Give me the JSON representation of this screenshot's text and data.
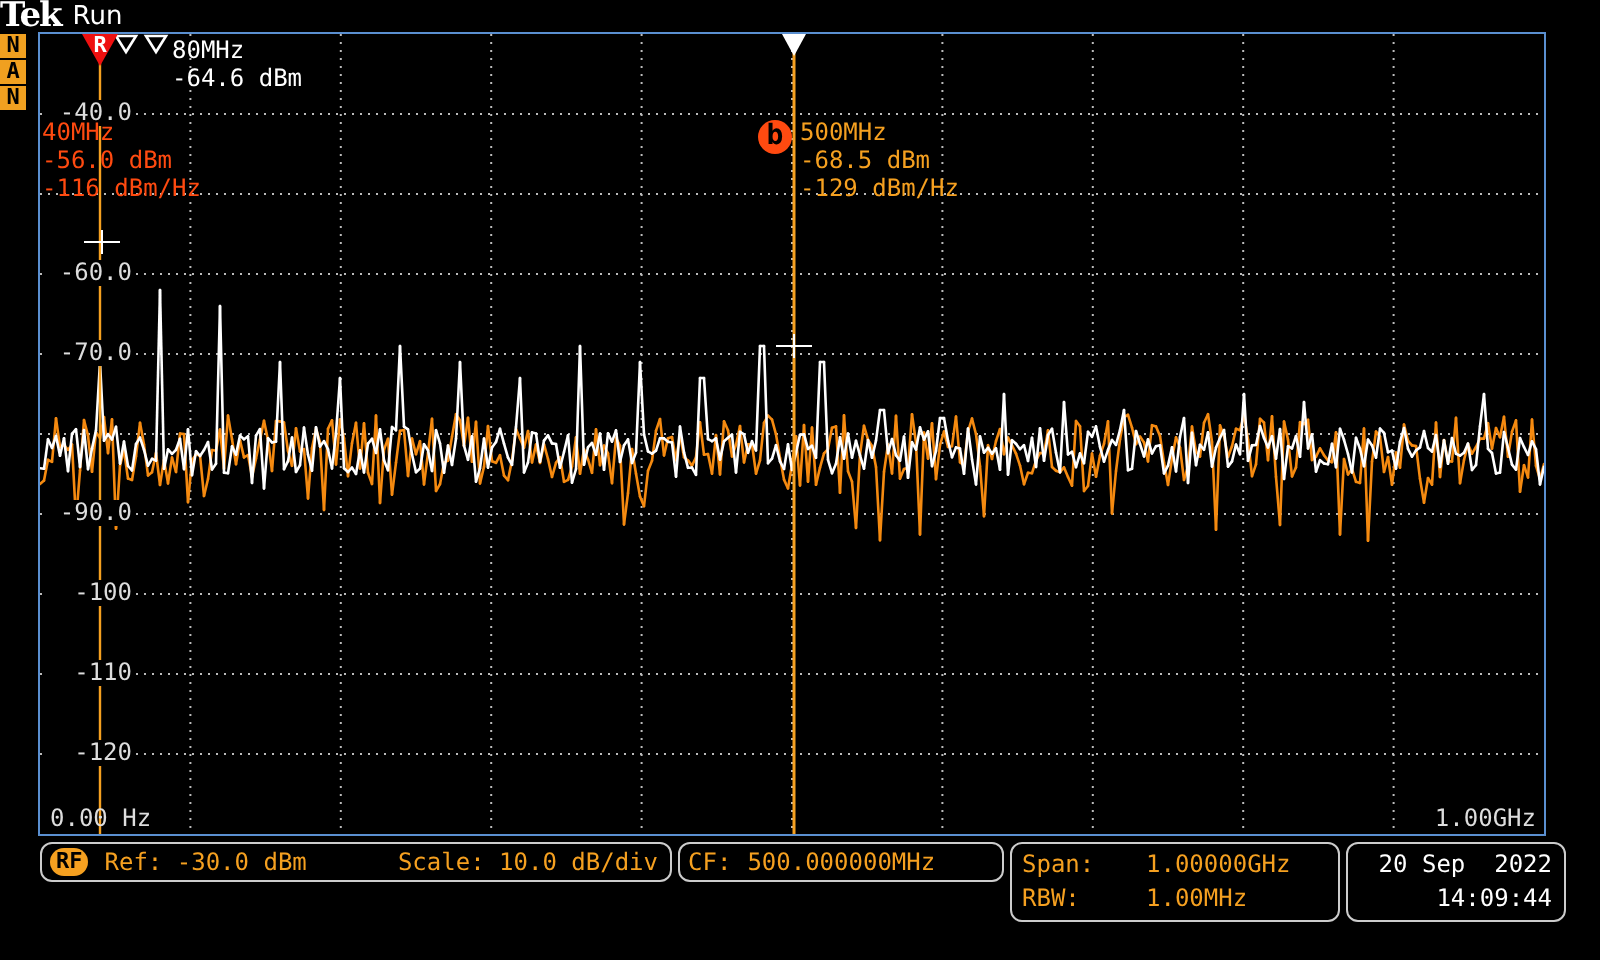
{
  "header": {
    "logo": "Tek",
    "status": "Run"
  },
  "side_badges": [
    "N",
    "A",
    "N"
  ],
  "plot": {
    "y_labels": [
      "-40.0",
      "-60.0",
      "-70.0",
      "-90.0",
      "-100",
      "-110",
      "-120"
    ],
    "x_start": "0.00 Hz",
    "x_end": "1.00GHz",
    "reference_marker": {
      "label": "R"
    },
    "delta_readout": {
      "frequency": "80MHz",
      "power": "-64.6 dBm"
    },
    "marker_a_readout": {
      "frequency": "40MHz",
      "power": "-56.0 dBm",
      "density": "-116 dBm/Hz"
    },
    "marker_b": {
      "label": "b",
      "frequency": "500MHz",
      "power": "-68.5 dBm",
      "density": "-129 dBm/Hz"
    }
  },
  "status_bar": {
    "badge": "RF",
    "ref": "Ref: -30.0 dBm",
    "scale": "Scale: 10.0 dB/div",
    "cf_label": "CF:",
    "cf_value": "500.000000MHz",
    "span_label": "Span:",
    "span_value": "1.00000GHz",
    "rbw_label": "RBW:",
    "rbw_value": "1.00MHz",
    "date": "20 Sep  2022",
    "time": "14:09:44"
  }
}
